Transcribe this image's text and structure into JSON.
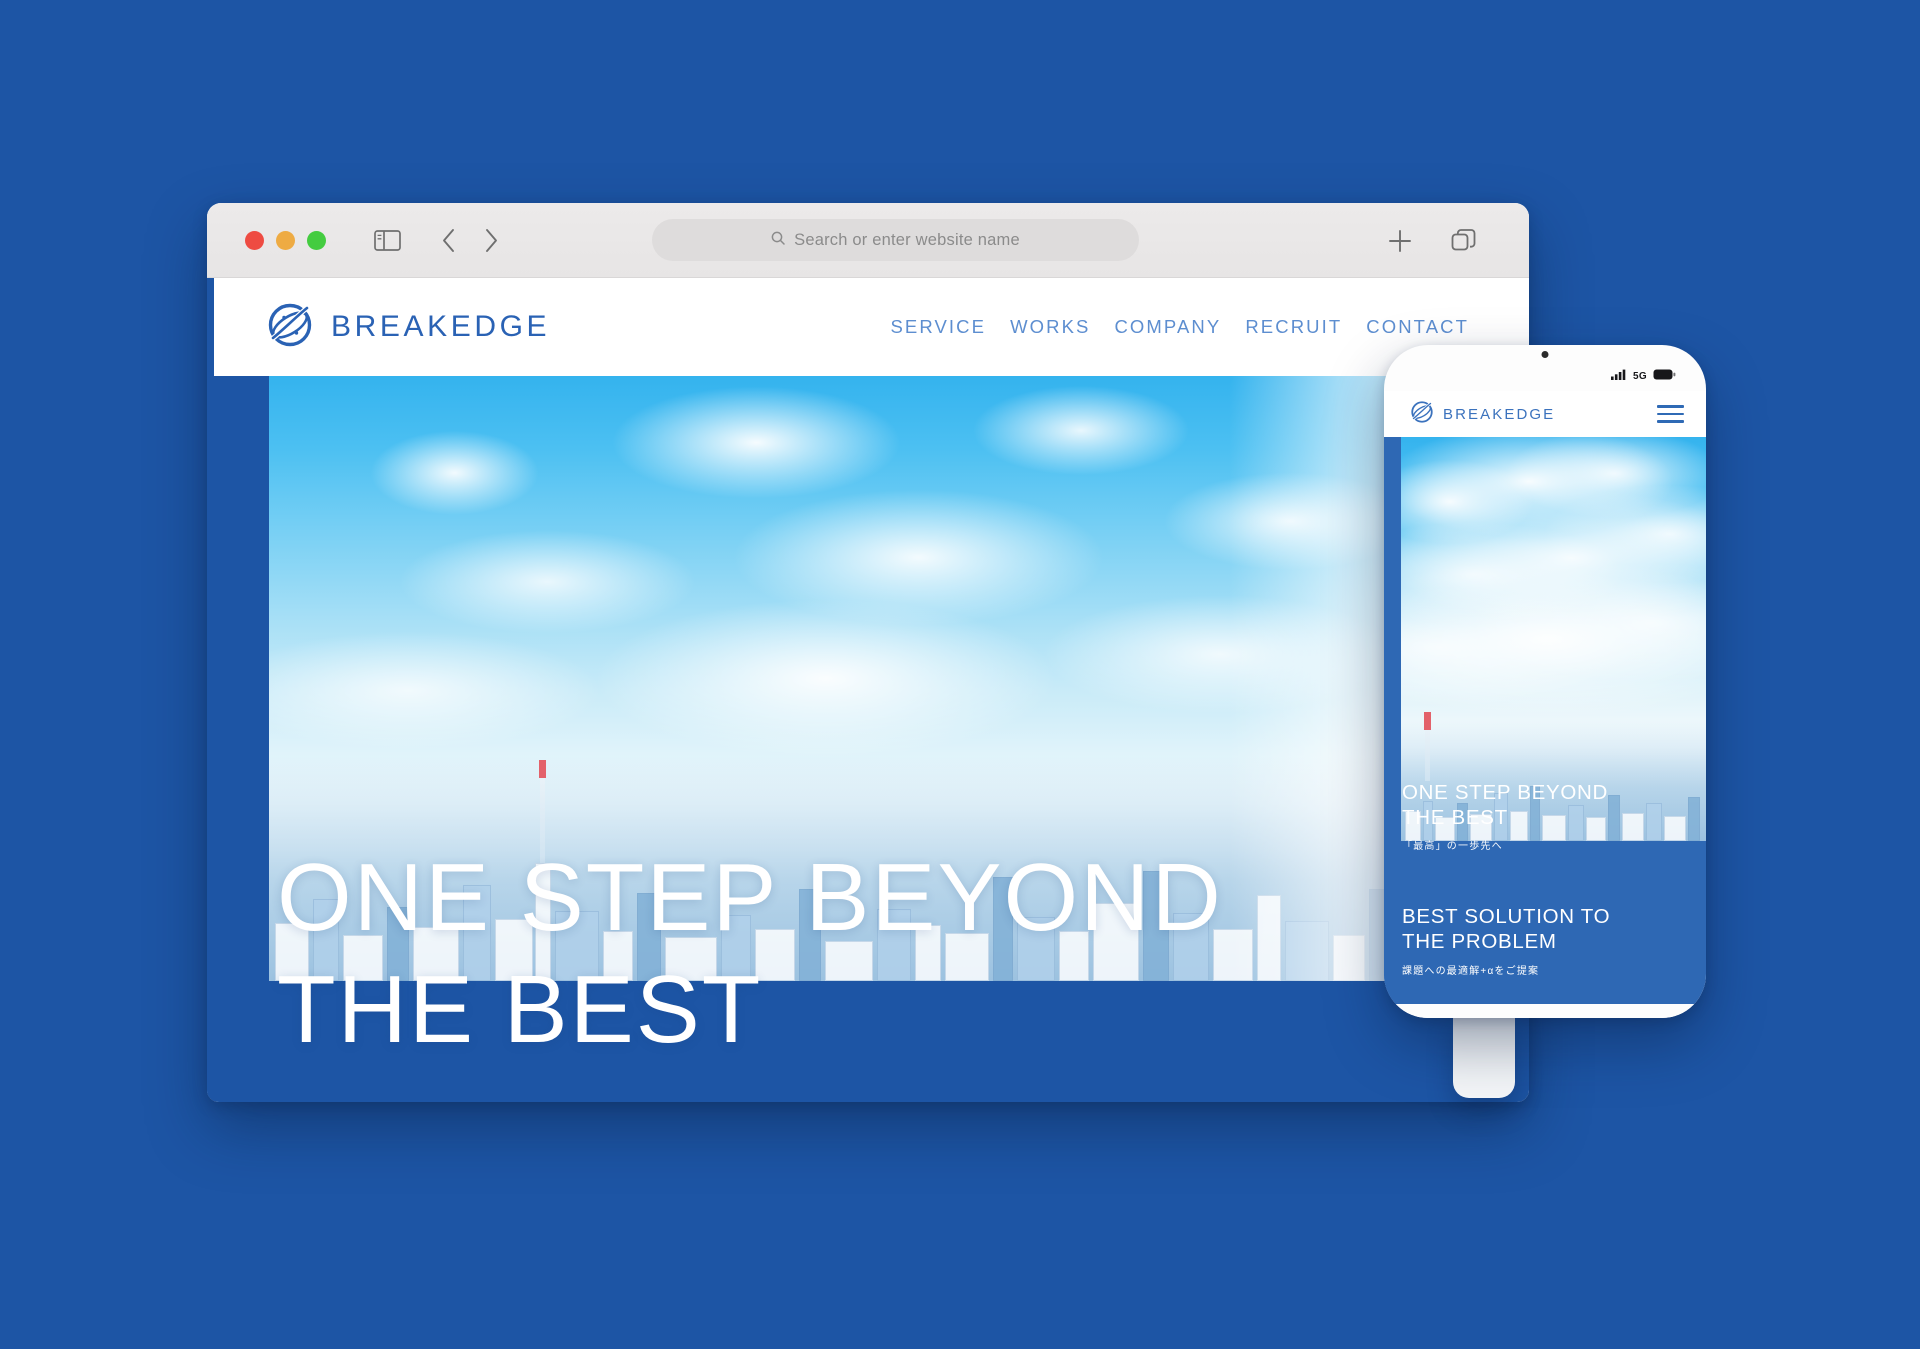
{
  "canvas": {
    "background_color": "#1d55a5"
  },
  "browser": {
    "window_controls": [
      {
        "name": "close",
        "color": "#ee4b42"
      },
      {
        "name": "minimize",
        "color": "#eeab43"
      },
      {
        "name": "maximize",
        "color": "#44cc40"
      }
    ],
    "toolbar": {
      "sidebar_icon": "sidebar-icon",
      "back_icon": "chevron-left-icon",
      "forward_icon": "chevron-right-icon",
      "new_tab_icon": "plus-icon",
      "tab_overview_icon": "copy-tabs-icon"
    },
    "address_bar": {
      "search_icon": "search-icon",
      "placeholder": "Search or enter website name",
      "value": ""
    }
  },
  "site": {
    "brand": {
      "name": "BREAKEDGE",
      "logo_icon": "breakedge-globe-logo",
      "color": "#2a62b4"
    },
    "nav": [
      {
        "label": "SERVICE"
      },
      {
        "label": "WORKS"
      },
      {
        "label": "COMPANY"
      },
      {
        "label": "RECRUIT"
      },
      {
        "label": "CONTACT"
      }
    ],
    "hero": {
      "line1": "ONE STEP BEYOND",
      "line2": "THE BEST",
      "image_alt": "Tokyo skyline under blue sky with clouds"
    }
  },
  "phone": {
    "status": {
      "signal_icon": "cellular-bars-icon",
      "network": "5G",
      "battery_icon": "battery-icon"
    },
    "brand": {
      "name": "BREAKEDGE",
      "logo_icon": "breakedge-globe-logo"
    },
    "menu_icon": "hamburger-menu-icon",
    "hero": {
      "line1": "ONE STEP BEYOND",
      "line2": "THE BEST",
      "subtitle_jp": "「最高」の一歩先へ"
    },
    "secondary": {
      "line1": "BEST SOLUTION TO",
      "line2": "THE PROBLEM",
      "subtitle_jp": "課題への最適解+αをご提案"
    }
  }
}
